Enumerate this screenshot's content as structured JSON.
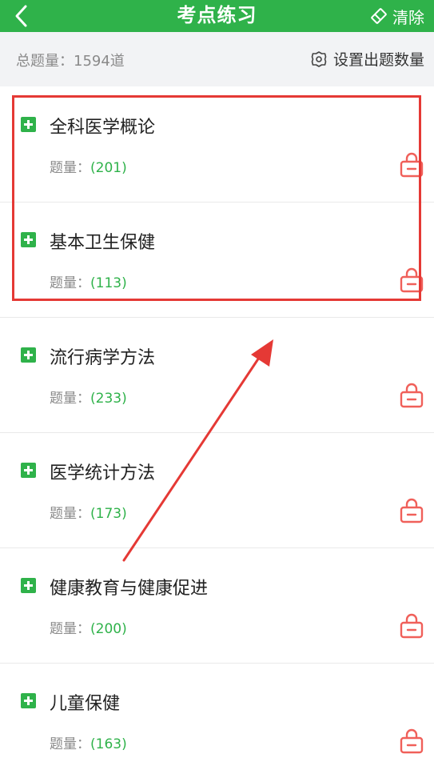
{
  "header": {
    "title": "考点练习",
    "clear_label": "清除"
  },
  "subbar": {
    "total_label": "总题量：1594道",
    "set_count_label": "设置出题数量"
  },
  "count_label": "题量：",
  "items": [
    {
      "title": "全科医学概论",
      "count": "(201)"
    },
    {
      "title": "基本卫生保健",
      "count": "(113)"
    },
    {
      "title": "流行病学方法",
      "count": "(233)"
    },
    {
      "title": "医学统计方法",
      "count": "(173)"
    },
    {
      "title": "健康教育与健康促进",
      "count": "(200)"
    },
    {
      "title": "儿童保健",
      "count": "(163)"
    }
  ],
  "colors": {
    "brand_green": "#2fb24a",
    "annotation_red": "#e53935",
    "lock_red": "#f0605a"
  }
}
